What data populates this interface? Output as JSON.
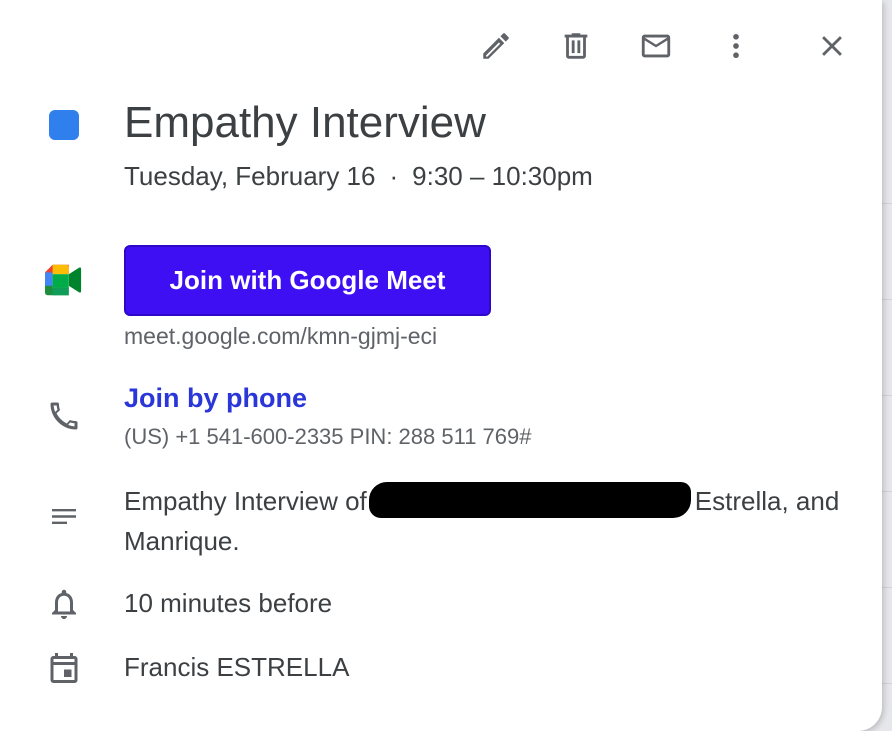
{
  "event": {
    "title": "Empathy Interview",
    "date": "Tuesday, February 16",
    "separator": "·",
    "time": "9:30 – 10:30pm",
    "color": "#2f80ed"
  },
  "toolbar": {
    "icons": [
      "edit-icon",
      "delete-icon",
      "email-icon",
      "more-icon",
      "close-icon"
    ]
  },
  "conference": {
    "join_button_label": "Join with Google Meet",
    "button_color": "#3d0ff2",
    "link": "meet.google.com/kmn-gjmj-eci"
  },
  "phone": {
    "link_label": "Join by phone",
    "detail": "(US) +1 541-600-2335 PIN: 288 511 769#"
  },
  "description": {
    "text_before": "Empathy Interview of",
    "text_after": "Estrella, and Manrique."
  },
  "reminder": "10 minutes before",
  "calendar_owner": "Francis ESTRELLA"
}
